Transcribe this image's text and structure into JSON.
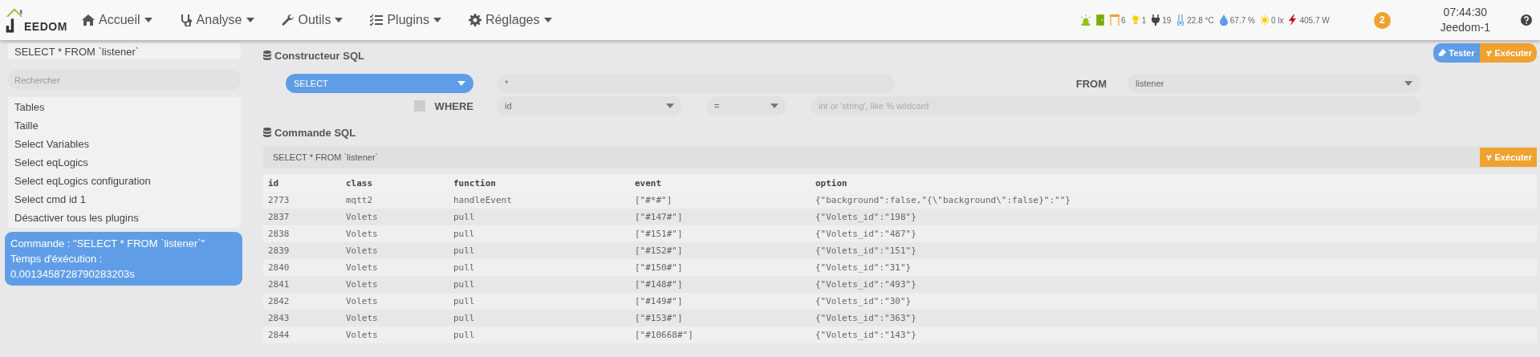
{
  "navbar": {
    "logo": "EEDOM",
    "menu": [
      {
        "kind": "home",
        "label": "Accueil"
      },
      {
        "kind": "stethoscope",
        "label": "Analyse"
      },
      {
        "kind": "wrench",
        "label": "Outils"
      },
      {
        "kind": "list",
        "label": "Plugins"
      },
      {
        "kind": "gear",
        "label": "Réglages"
      }
    ],
    "status_items": [
      {
        "kind": "alarm"
      },
      {
        "kind": "door"
      },
      {
        "kind": "shutter",
        "value": "6"
      },
      {
        "kind": "light",
        "value": "1"
      },
      {
        "kind": "plug",
        "value": "19"
      },
      {
        "kind": "temperature",
        "value": "22.8 °C"
      },
      {
        "kind": "humidity",
        "value": "67.7 %"
      },
      {
        "kind": "luminosity",
        "value": "0 lx"
      },
      {
        "kind": "power",
        "value": "405.7 W"
      }
    ],
    "notifications": "2",
    "clock": "07:44:30",
    "host": "Jeedom-1"
  },
  "sidebar": {
    "current_query": "SELECT * FROM `listener`",
    "search": {
      "placeholder": "Rechercher"
    },
    "items": [
      "Tables",
      "Taille",
      "Select Variables",
      "Select eqLogics",
      "Select eqLogics configuration",
      "Select cmd id 1",
      "Désactiver tous les plugins"
    ],
    "result_info": [
      "Commande : \"SELECT * FROM `listener`\"",
      "Temps d'éxécution :",
      "0.0013458728790283203s"
    ]
  },
  "builder": {
    "title": "Constructeur SQL",
    "buttons": [
      {
        "kind": "test",
        "label": "Tester"
      },
      {
        "kind": "run",
        "label": "Exécuter"
      }
    ],
    "operation": "SELECT",
    "fields": "*",
    "from_label": "FROM",
    "table": "listener",
    "where_enabled": false,
    "where_label": "WHERE",
    "where_column": "id",
    "where_operator": "=",
    "where_value": {
      "placeholder": "int or 'string', like % wildcard"
    }
  },
  "command": {
    "title": "Commande SQL",
    "query": "SELECT * FROM `listener`",
    "button": "Exécuter"
  },
  "table": {
    "columns": [
      "id",
      "class",
      "function",
      "event",
      "option"
    ],
    "rows": [
      [
        "2773",
        "mqtt2",
        "handleEvent",
        "[\"#*#\"]",
        "{\"background\":false,\"{\\\"background\\\":false}\":\"\"}"
      ],
      [
        "2837",
        "Volets",
        "pull",
        "[\"#147#\"]",
        "{\"Volets_id\":\"198\"}"
      ],
      [
        "2838",
        "Volets",
        "pull",
        "[\"#151#\"]",
        "{\"Volets_id\":\"487\"}"
      ],
      [
        "2839",
        "Volets",
        "pull",
        "[\"#152#\"]",
        "{\"Volets_id\":\"151\"}"
      ],
      [
        "2840",
        "Volets",
        "pull",
        "[\"#150#\"]",
        "{\"Volets_id\":\"31\"}"
      ],
      [
        "2841",
        "Volets",
        "pull",
        "[\"#148#\"]",
        "{\"Volets_id\":\"493\"}"
      ],
      [
        "2842",
        "Volets",
        "pull",
        "[\"#149#\"]",
        "{\"Volets_id\":\"30\"}"
      ],
      [
        "2843",
        "Volets",
        "pull",
        "[\"#153#\"]",
        "{\"Volets_id\":\"363\"}"
      ],
      [
        "2844",
        "Volets",
        "pull",
        "[\"#10668#\"]",
        "{\"Volets_id\":\"143\"}"
      ]
    ]
  }
}
